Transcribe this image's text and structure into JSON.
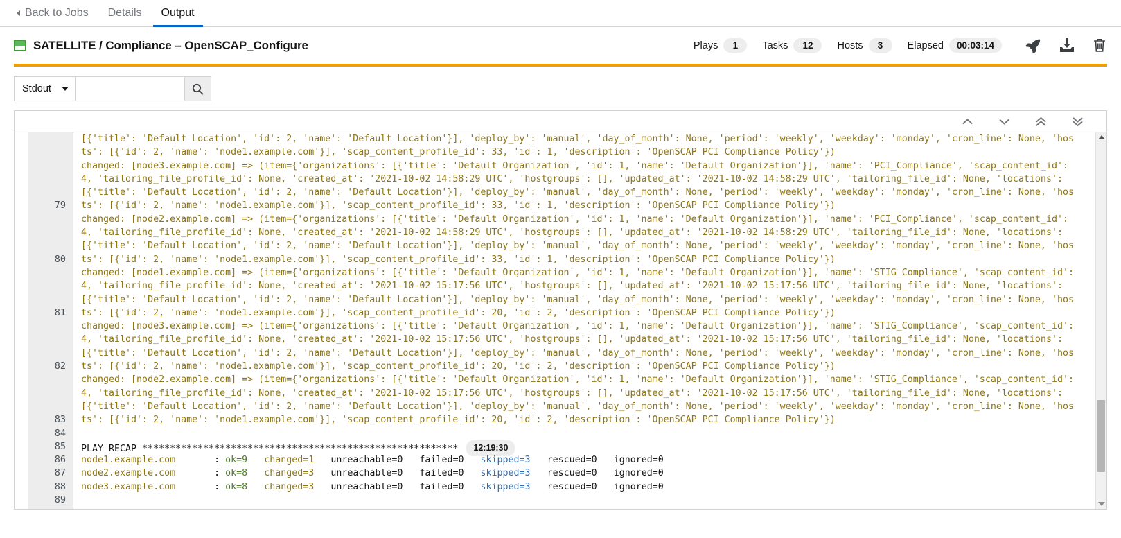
{
  "tabs": [
    {
      "label": "Back to Jobs",
      "name": "back-to-jobs",
      "active": false
    },
    {
      "label": "Details",
      "name": "tab-details",
      "active": false
    },
    {
      "label": "Output",
      "name": "tab-output",
      "active": true
    }
  ],
  "job": {
    "title": "SATELLITE / Compliance – OpenSCAP_Configure",
    "status_color": "#ec9f08",
    "icon": "job-status-square-icon",
    "stats": [
      {
        "label": "Plays",
        "value": "1"
      },
      {
        "label": "Tasks",
        "value": "12"
      },
      {
        "label": "Hosts",
        "value": "3"
      },
      {
        "label": "Elapsed",
        "value": "00:03:14"
      }
    ],
    "actions": [
      {
        "name": "relaunch-rocket-icon",
        "title": "Relaunch"
      },
      {
        "name": "download-icon",
        "title": "Download"
      },
      {
        "name": "delete-trash-icon",
        "title": "Delete"
      }
    ]
  },
  "toolbar": {
    "select_value": "Stdout",
    "select_options": [
      "Stdout"
    ],
    "search_value": "",
    "search_placeholder": "",
    "search_button": "search-icon"
  },
  "output_nav": [
    {
      "name": "scroll-previous-icon",
      "glyph": "chevron-up"
    },
    {
      "name": "scroll-next-icon",
      "glyph": "chevron-down"
    },
    {
      "name": "scroll-first-icon",
      "glyph": "double-chevron-up"
    },
    {
      "name": "scroll-last-icon",
      "glyph": "double-chevron-down"
    }
  ],
  "output": {
    "colors": {
      "changed": "#8f7611",
      "ok": "#4f7f28",
      "skipped": "#2b6cb8",
      "plain": "#151515"
    },
    "lines": [
      {
        "num": "",
        "rows": [
          {
            "cls": "c-changed",
            "text": "[{'title': 'Default Location', 'id': 2, 'name': 'Default Location'}], 'deploy_by': 'manual', 'day_of_month': None, 'period': 'weekly', 'weekday': 'monday', 'cron_line': None, 'hos"
          },
          {
            "cls": "c-changed",
            "text": "ts': [{'id': 2, 'name': 'node1.example.com'}], 'scap_content_profile_id': 33, 'id': 1, 'description': 'OpenSCAP PCI Compliance Policy'})"
          }
        ]
      },
      {
        "num": "79",
        "rows": [
          {
            "cls": "c-changed",
            "text": "changed: [node3.example.com] => (item={'organizations': [{'title': 'Default Organization', 'id': 1, 'name': 'Default Organization'}], 'name': 'PCI_Compliance', 'scap_content_id':"
          },
          {
            "cls": "c-changed",
            "text": "4, 'tailoring_file_profile_id': None, 'created_at': '2021-10-02 14:58:29 UTC', 'hostgroups': [], 'updated_at': '2021-10-02 14:58:29 UTC', 'tailoring_file_id': None, 'locations':"
          },
          {
            "cls": "c-changed",
            "text": "[{'title': 'Default Location', 'id': 2, 'name': 'Default Location'}], 'deploy_by': 'manual', 'day_of_month': None, 'period': 'weekly', 'weekday': 'monday', 'cron_line': None, 'hos"
          },
          {
            "cls": "c-changed",
            "text": "ts': [{'id': 2, 'name': 'node1.example.com'}], 'scap_content_profile_id': 33, 'id': 1, 'description': 'OpenSCAP PCI Compliance Policy'})"
          }
        ]
      },
      {
        "num": "80",
        "rows": [
          {
            "cls": "c-changed",
            "text": "changed: [node2.example.com] => (item={'organizations': [{'title': 'Default Organization', 'id': 1, 'name': 'Default Organization'}], 'name': 'PCI_Compliance', 'scap_content_id':"
          },
          {
            "cls": "c-changed",
            "text": "4, 'tailoring_file_profile_id': None, 'created_at': '2021-10-02 14:58:29 UTC', 'hostgroups': [], 'updated_at': '2021-10-02 14:58:29 UTC', 'tailoring_file_id': None, 'locations':"
          },
          {
            "cls": "c-changed",
            "text": "[{'title': 'Default Location', 'id': 2, 'name': 'Default Location'}], 'deploy_by': 'manual', 'day_of_month': None, 'period': 'weekly', 'weekday': 'monday', 'cron_line': None, 'hos"
          },
          {
            "cls": "c-changed",
            "text": "ts': [{'id': 2, 'name': 'node1.example.com'}], 'scap_content_profile_id': 33, 'id': 1, 'description': 'OpenSCAP PCI Compliance Policy'})"
          }
        ]
      },
      {
        "num": "81",
        "rows": [
          {
            "cls": "c-changed",
            "text": "changed: [node1.example.com] => (item={'organizations': [{'title': 'Default Organization', 'id': 1, 'name': 'Default Organization'}], 'name': 'STIG_Compliance', 'scap_content_id':"
          },
          {
            "cls": "c-changed",
            "text": "4, 'tailoring_file_profile_id': None, 'created_at': '2021-10-02 15:17:56 UTC', 'hostgroups': [], 'updated_at': '2021-10-02 15:17:56 UTC', 'tailoring_file_id': None, 'locations':"
          },
          {
            "cls": "c-changed",
            "text": "[{'title': 'Default Location', 'id': 2, 'name': 'Default Location'}], 'deploy_by': 'manual', 'day_of_month': None, 'period': 'weekly', 'weekday': 'monday', 'cron_line': None, 'hos"
          },
          {
            "cls": "c-changed",
            "text": "ts': [{'id': 2, 'name': 'node1.example.com'}], 'scap_content_profile_id': 20, 'id': 2, 'description': 'OpenSCAP PCI Compliance Policy'})"
          }
        ]
      },
      {
        "num": "82",
        "rows": [
          {
            "cls": "c-changed",
            "text": "changed: [node3.example.com] => (item={'organizations': [{'title': 'Default Organization', 'id': 1, 'name': 'Default Organization'}], 'name': 'STIG_Compliance', 'scap_content_id':"
          },
          {
            "cls": "c-changed",
            "text": "4, 'tailoring_file_profile_id': None, 'created_at': '2021-10-02 15:17:56 UTC', 'hostgroups': [], 'updated_at': '2021-10-02 15:17:56 UTC', 'tailoring_file_id': None, 'locations':"
          },
          {
            "cls": "c-changed",
            "text": "[{'title': 'Default Location', 'id': 2, 'name': 'Default Location'}], 'deploy_by': 'manual', 'day_of_month': None, 'period': 'weekly', 'weekday': 'monday', 'cron_line': None, 'hos"
          },
          {
            "cls": "c-changed",
            "text": "ts': [{'id': 2, 'name': 'node1.example.com'}], 'scap_content_profile_id': 20, 'id': 2, 'description': 'OpenSCAP PCI Compliance Policy'})"
          }
        ]
      },
      {
        "num": "83",
        "rows": [
          {
            "cls": "c-changed",
            "text": "changed: [node2.example.com] => (item={'organizations': [{'title': 'Default Organization', 'id': 1, 'name': 'Default Organization'}], 'name': 'STIG_Compliance', 'scap_content_id':"
          },
          {
            "cls": "c-changed",
            "text": "4, 'tailoring_file_profile_id': None, 'created_at': '2021-10-02 15:17:56 UTC', 'hostgroups': [], 'updated_at': '2021-10-02 15:17:56 UTC', 'tailoring_file_id': None, 'locations':"
          },
          {
            "cls": "c-changed",
            "text": "[{'title': 'Default Location', 'id': 2, 'name': 'Default Location'}], 'deploy_by': 'manual', 'day_of_month': None, 'period': 'weekly', 'weekday': 'monday', 'cron_line': None, 'hos"
          },
          {
            "cls": "c-changed",
            "text": "ts': [{'id': 2, 'name': 'node1.example.com'}], 'scap_content_profile_id': 20, 'id': 2, 'description': 'OpenSCAP PCI Compliance Policy'})"
          }
        ]
      },
      {
        "num": "84",
        "rows": [
          {
            "cls": "c-plain",
            "text": ""
          }
        ]
      }
    ],
    "recap": {
      "num": "85",
      "header": "PLAY RECAP *********************************************************",
      "timestamp": "12:19:30",
      "hosts": [
        {
          "num": "86",
          "host": "node1.example.com",
          "pad": "       ",
          "sep": ": ",
          "ok": "ok=9",
          "changed": "changed=1",
          "unreachable": "unreachable=0",
          "failed": "failed=0",
          "skipped": "skipped=3",
          "rescued": "rescued=0",
          "ignored": "ignored=0"
        },
        {
          "num": "87",
          "host": "node2.example.com",
          "pad": "       ",
          "sep": ": ",
          "ok": "ok=8",
          "changed": "changed=3",
          "unreachable": "unreachable=0",
          "failed": "failed=0",
          "skipped": "skipped=3",
          "rescued": "rescued=0",
          "ignored": "ignored=0"
        },
        {
          "num": "88",
          "host": "node3.example.com",
          "pad": "       ",
          "sep": ": ",
          "ok": "ok=8",
          "changed": "changed=3",
          "unreachable": "unreachable=0",
          "failed": "failed=0",
          "skipped": "skipped=3",
          "rescued": "rescued=0",
          "ignored": "ignored=0"
        }
      ],
      "last_num": "89"
    }
  }
}
